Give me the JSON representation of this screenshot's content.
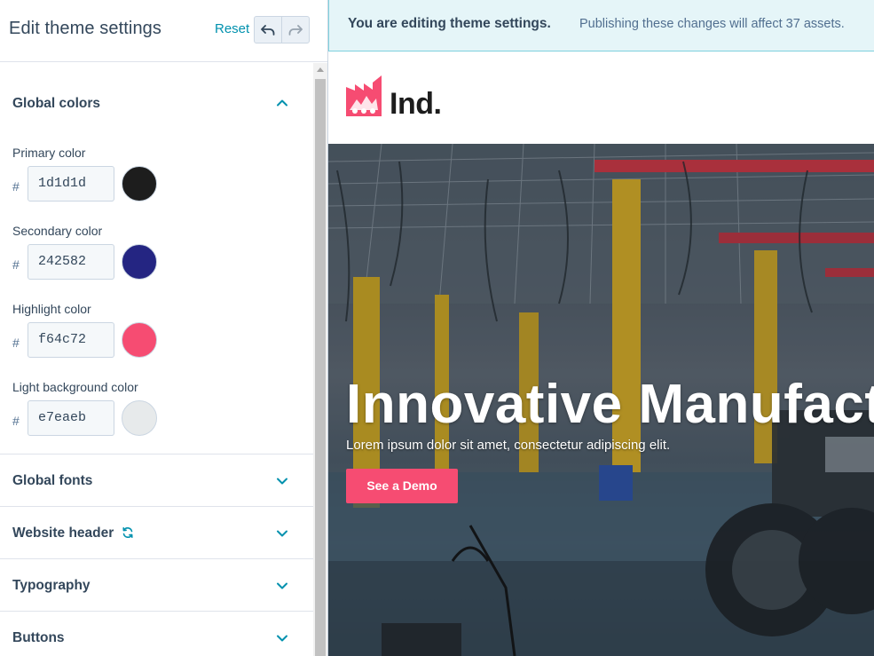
{
  "panel": {
    "title": "Edit theme settings",
    "reset_label": "Reset",
    "undo_icon": "undo-icon",
    "redo_icon": "redo-icon"
  },
  "sections": {
    "global_colors": {
      "label": "Global colors",
      "expanded": true,
      "colors": [
        {
          "label": "Primary color",
          "hash": "#",
          "value": "1d1d1d",
          "swatch": "#1d1d1d"
        },
        {
          "label": "Secondary color",
          "hash": "#",
          "value": "242582",
          "swatch": "#242582"
        },
        {
          "label": "Highlight color",
          "hash": "#",
          "value": "f64c72",
          "swatch": "#f64c72"
        },
        {
          "label": "Light background color",
          "hash": "#",
          "value": "e7eaeb",
          "swatch": "#e7eaeb"
        }
      ]
    },
    "global_fonts": {
      "label": "Global fonts"
    },
    "website_header": {
      "label": "Website header"
    },
    "typography": {
      "label": "Typography"
    },
    "buttons": {
      "label": "Buttons"
    }
  },
  "banner": {
    "strong": "You are editing theme settings.",
    "text": "Publishing these changes will affect 37 assets."
  },
  "preview": {
    "logo_text": "Ind.",
    "hero_title": "Innovative Manufacturing",
    "hero_subtitle": "Lorem ipsum dolor sit amet, consectetur adipiscing elit.",
    "hero_button": "See a Demo"
  },
  "colors": {
    "accent": "#0091ae",
    "highlight": "#f64c72",
    "banner_bg": "#e5f5f8"
  }
}
